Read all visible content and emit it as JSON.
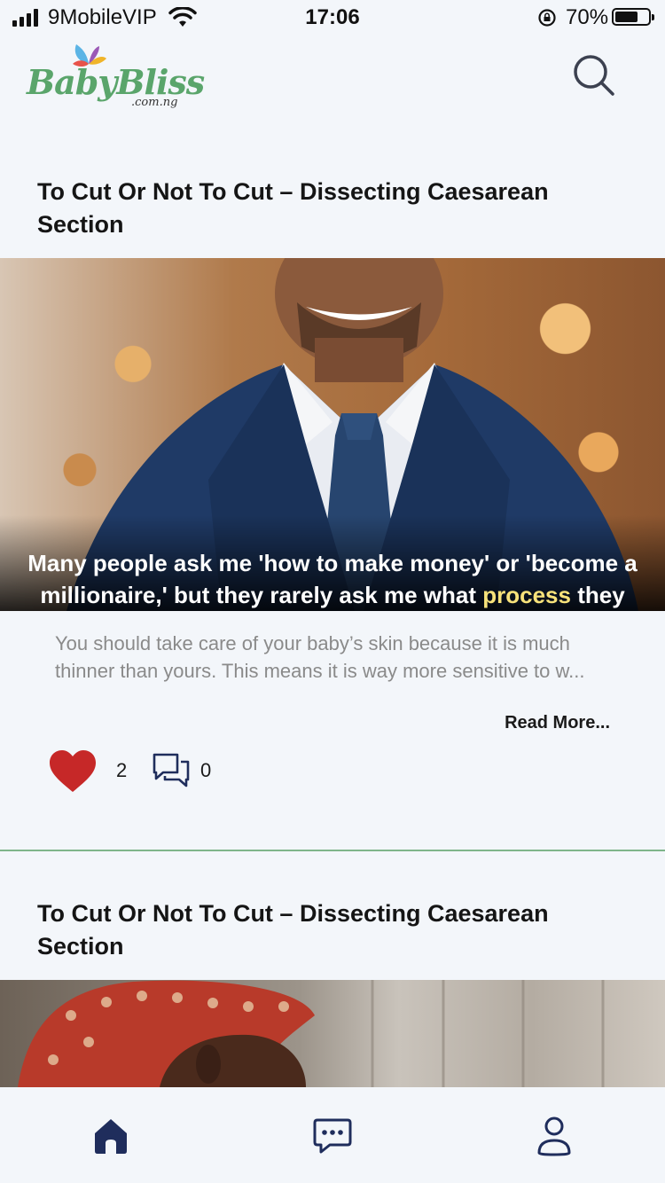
{
  "status_bar": {
    "carrier": "9MobileVIP",
    "time": "17:06",
    "battery_percent": "70%",
    "battery_level": 0.7
  },
  "header": {
    "logo_text": "BabyBliss",
    "logo_subtext": ".com.ng",
    "search_icon": "search-icon"
  },
  "posts": [
    {
      "title": "To Cut Or Not To Cut – Dissecting Caesarean Section",
      "image_quote_line1": "Many people ask me 'how to make money' or 'become a",
      "image_quote_line2_a": "millionaire,' but they rarely ask me what ",
      "image_quote_highlight": "process",
      "image_quote_line2_b": " they",
      "excerpt": "You should take care of your baby’s skin because it is much thinner than yours. This means it is way more sensitive to w...",
      "read_more": "Read More...",
      "likes": "2",
      "comments": "0"
    },
    {
      "title": "To Cut Or Not To Cut – Dissecting Caesarean Section"
    }
  ],
  "bottom_nav": [
    {
      "icon": "home-icon"
    },
    {
      "icon": "chat-icon"
    },
    {
      "icon": "profile-icon"
    }
  ],
  "colors": {
    "background": "#f3f6fa",
    "brand_green": "#5aa56b",
    "like_red": "#c62828",
    "nav_icon": "#1f2d5c",
    "divider": "#7fb58a"
  }
}
